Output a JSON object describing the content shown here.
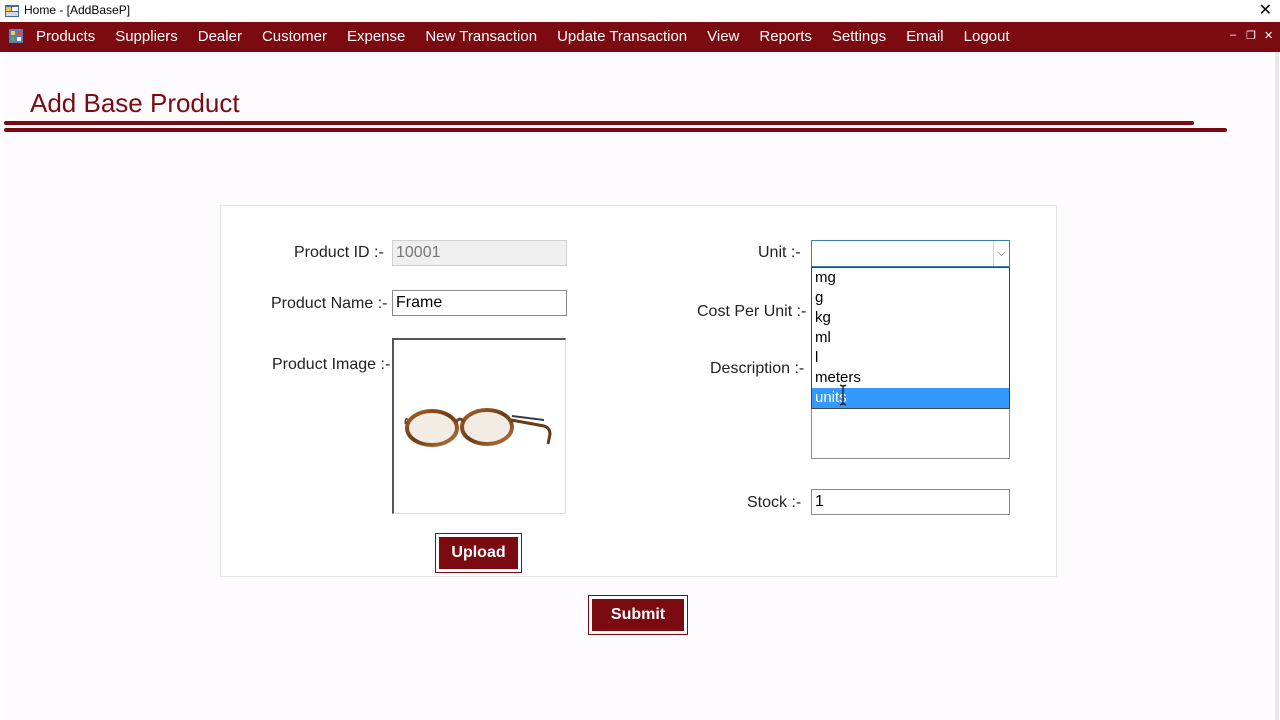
{
  "window": {
    "title": "Home - [AddBaseP]",
    "close_glyph": "✕"
  },
  "menu": {
    "items": [
      "Products",
      "Suppliers",
      "Dealer",
      "Customer",
      "Expense",
      "New Transaction",
      "Update Transaction",
      "View",
      "Reports",
      "Settings",
      "Email",
      "Logout"
    ],
    "minimize_glyph": "–",
    "restore_glyph": "❐",
    "close_glyph": "✕"
  },
  "page": {
    "title": "Add Base Product"
  },
  "form": {
    "product_id_label": "Product ID  :-",
    "product_id_value": "10001",
    "product_name_label": "Product Name  :-",
    "product_name_value": "Frame",
    "product_image_label": "Product Image :-",
    "upload_label": "Upload",
    "unit_label": "Unit  :-",
    "unit_value": "",
    "unit_options": [
      "mg",
      "g",
      "kg",
      "ml",
      "l",
      "meters",
      "units"
    ],
    "unit_highlighted": "units",
    "cost_label": "Cost Per Unit  :-",
    "description_label": "Description  :-",
    "stock_label": "Stock  :-",
    "stock_value": "1",
    "submit_label": "Submit"
  },
  "colors": {
    "brand": "#7b0b11",
    "highlight": "#3399ff"
  },
  "icons": {
    "app": "app-icon",
    "combo_arrow": "chevron-down-icon",
    "cursor": "text-cursor-icon",
    "product_image": "eyeglasses-image"
  }
}
